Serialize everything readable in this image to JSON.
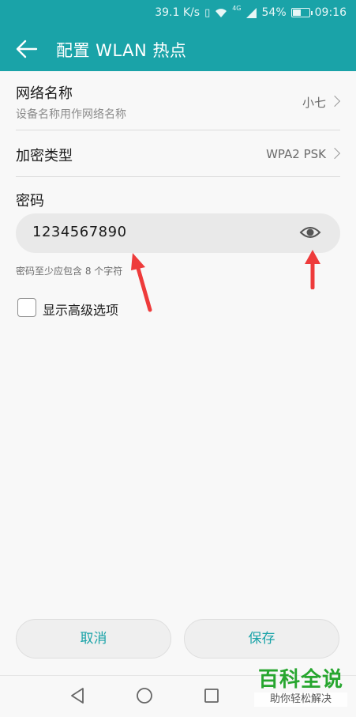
{
  "status_bar": {
    "speed": "39.1 K/s",
    "network": "4G",
    "battery": "54%",
    "battery_level": 0.54,
    "time": "09:16"
  },
  "app_bar": {
    "title": "配置 WLAN 热点",
    "back_icon": "arrow-left-icon"
  },
  "settings": {
    "network_name": {
      "label": "网络名称",
      "subtitle": "设备名称用作网络名称",
      "value": "小七"
    },
    "encryption": {
      "label": "加密类型",
      "value": "WPA2 PSK"
    },
    "password": {
      "label": "密码",
      "value": "1234567890",
      "hint": "密码至少应包含 8 个字符",
      "toggle_icon": "eye-icon"
    },
    "advanced": {
      "label": "显示高级选项",
      "checked": false
    }
  },
  "actions": {
    "cancel_label": "取消",
    "save_label": "保存"
  },
  "nav": {
    "back_icon": "triangle-back-icon",
    "home_icon": "circle-home-icon",
    "recents_icon": "square-recents-icon"
  },
  "watermark": {
    "title": "百科全说",
    "subtitle": "助你轻松解决"
  },
  "colors": {
    "accent": "#1aa3a8",
    "arrow": "#ee3b3b",
    "watermark": "#27a62f"
  }
}
